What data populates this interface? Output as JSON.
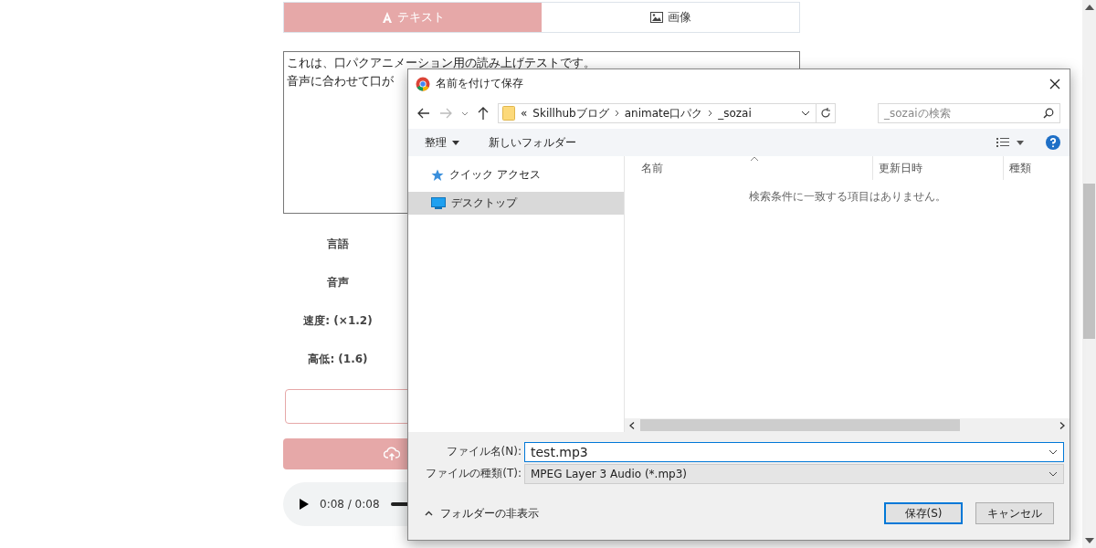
{
  "tabs": [
    {
      "label": "テキスト",
      "kind": "text",
      "selected": true
    },
    {
      "label": "画像",
      "kind": "image",
      "selected": false
    }
  ],
  "textarea": {
    "lines": [
      "これは、口パクアニメーション用の読み上げテストです。",
      "音声に合わせて口が"
    ]
  },
  "settings": [
    {
      "label": "言語"
    },
    {
      "label": "音声"
    },
    {
      "label": "速度: (×1.2)"
    },
    {
      "label": "高低: (1.6)"
    }
  ],
  "audio": {
    "time": "0:08 / 0:08",
    "level": 1
  },
  "dialog": {
    "title": "名前を付けて保存",
    "breadcrumb": [
      "«",
      "Skillhubブログ",
      "animate口パク",
      "_sozai"
    ],
    "search": {
      "placeholder": "_sozaiの検索"
    },
    "toolbar": [
      {
        "label": "整理",
        "dropdown": true
      },
      {
        "label": "新しいフォルダー",
        "dropdown": false
      }
    ],
    "nav_items": [
      {
        "label": "クイック アクセス",
        "kind": "star",
        "selected": false
      },
      {
        "label": "デスクトップ",
        "kind": "desktop",
        "selected": true
      }
    ],
    "columns": [
      "名前",
      "更新日時",
      "種類"
    ],
    "empty_message": "検索条件に一致する項目はありません。",
    "file_name": {
      "label": "ファイル名(N):",
      "value": "test.mp3"
    },
    "file_type": {
      "label": "ファイルの種類(T):",
      "value": "MPEG Layer 3 Audio (*.mp3)"
    },
    "hide_folders": "フォルダーの非表示",
    "buttons": [
      {
        "label": "保存(S)",
        "selected": true
      },
      {
        "label": "キャンセル",
        "selected": false
      }
    ]
  }
}
